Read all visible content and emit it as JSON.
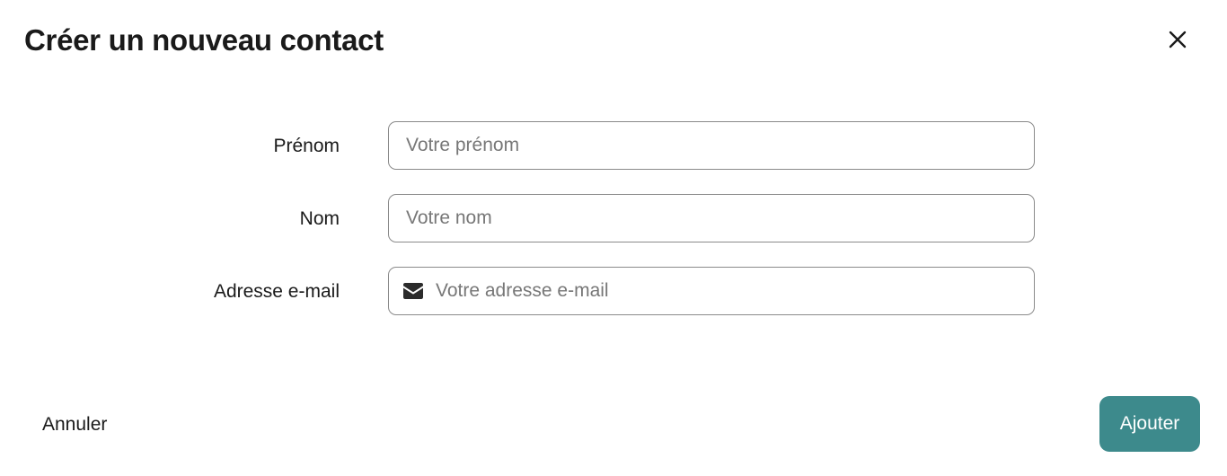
{
  "dialog": {
    "title": "Créer un nouveau contact",
    "close_icon": "close-icon"
  },
  "form": {
    "first_name": {
      "label": "Prénom",
      "placeholder": "Votre prénom",
      "value": ""
    },
    "last_name": {
      "label": "Nom",
      "placeholder": "Votre nom",
      "value": ""
    },
    "email": {
      "label": "Adresse e-mail",
      "placeholder": "Votre adresse e-mail",
      "value": "",
      "icon": "envelope-icon"
    }
  },
  "actions": {
    "cancel_label": "Annuler",
    "submit_label": "Ajouter"
  },
  "colors": {
    "accent": "#3d8a8c",
    "text": "#1a1a1a",
    "placeholder": "#777777",
    "border": "#8a8a8a"
  }
}
